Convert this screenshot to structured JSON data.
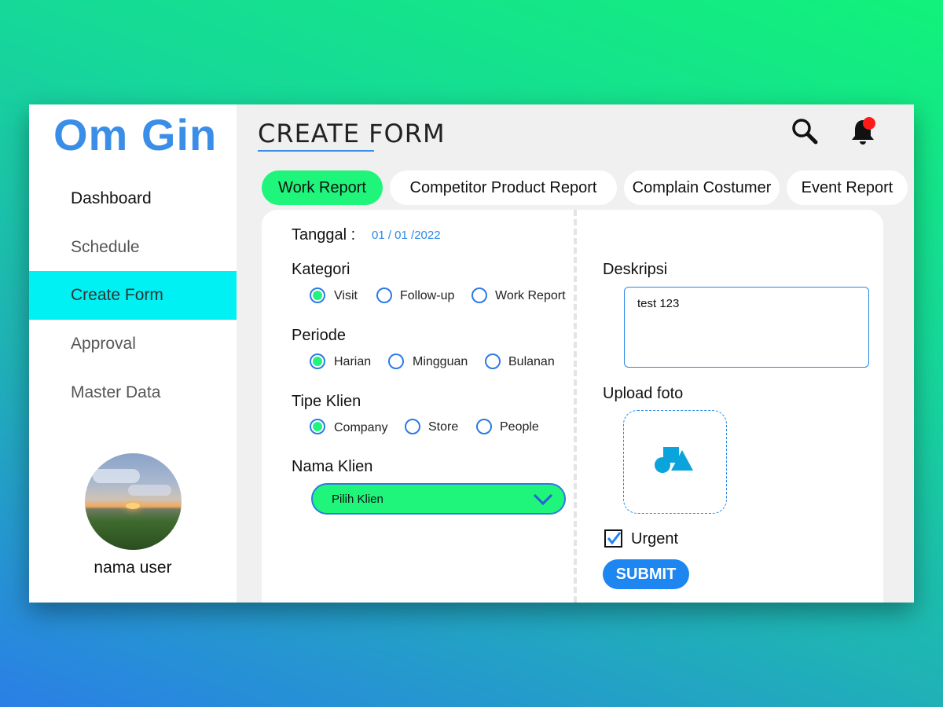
{
  "app": {
    "logo": "Om Gin"
  },
  "sidebar": {
    "items": [
      {
        "label": "Dashboard"
      },
      {
        "label": "Schedule"
      },
      {
        "label": "Create Form"
      },
      {
        "label": "Approval"
      },
      {
        "label": "Master Data"
      }
    ],
    "active_index": 2,
    "user_name": "nama user"
  },
  "header": {
    "title": "CREATE FORM"
  },
  "tabs": [
    {
      "label": "Work Report"
    },
    {
      "label": "Competitor Product Report"
    },
    {
      "label": "Complain Costumer"
    },
    {
      "label": "Event Report"
    }
  ],
  "form": {
    "tanggal_label": "Tanggal :",
    "tanggal_value": "01 / 01 /2022",
    "kategori": {
      "label": "Kategori",
      "options": [
        "Visit",
        "Follow-up",
        "Work Report"
      ],
      "selected": "Visit"
    },
    "periode": {
      "label": "Periode",
      "options": [
        "Harian",
        "Mingguan",
        "Bulanan"
      ],
      "selected": "Harian"
    },
    "tipe_klien": {
      "label": "Tipe Klien",
      "options": [
        "Company",
        "Store",
        "People"
      ],
      "selected": "Company"
    },
    "nama_klien": {
      "label": "Nama Klien",
      "placeholder": "Pilih Klien"
    },
    "deskripsi": {
      "label": "Deskripsi",
      "value": "test 123"
    },
    "upload_label": "Upload foto",
    "urgent": {
      "label": "Urgent",
      "checked": true
    },
    "submit_label": "SUBMIT"
  },
  "icons": {
    "search": "search-icon",
    "notification": "bell-icon",
    "upload": "shapes-icon",
    "dropdown": "chevron-down-icon"
  },
  "colors": {
    "accent_green": "#1ef57a",
    "accent_cyan": "#00f1f3",
    "primary_blue": "#1d86f0",
    "logo_blue": "#3a8ee8",
    "notification_dot": "#ff1a1a"
  }
}
